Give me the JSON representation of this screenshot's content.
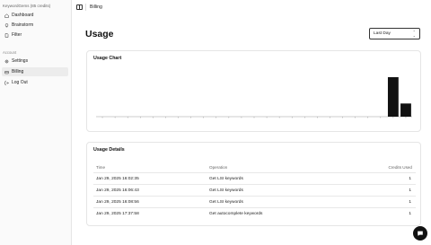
{
  "sidebar": {
    "brand": "KeywordGems (85 credits)",
    "items": [
      {
        "label": "Dashboard",
        "icon": "home-icon"
      },
      {
        "label": "Brainstorm",
        "icon": "lightbulb-icon"
      },
      {
        "label": "Filter",
        "icon": "file-icon"
      }
    ],
    "account_label": "Account",
    "account_items": [
      {
        "label": "Settings",
        "icon": "gear-icon"
      },
      {
        "label": "Billing",
        "icon": "credit-card-icon",
        "active": true
      },
      {
        "label": "Log Out",
        "icon": "logout-icon"
      }
    ]
  },
  "header": {
    "breadcrumb": "Billing"
  },
  "page": {
    "title": "Usage",
    "range_select": "Last Day"
  },
  "usage_chart": {
    "title": "Usage Chart"
  },
  "chart_data": {
    "type": "bar",
    "title": "Usage Chart",
    "values": [
      0,
      0,
      0,
      0,
      0,
      0,
      0,
      0,
      0,
      0,
      0,
      0,
      0,
      0,
      0,
      0,
      0,
      0,
      0,
      0,
      0,
      0,
      0,
      3,
      1
    ],
    "grid": false
  },
  "usage_details": {
    "title": "Usage Details",
    "columns": [
      "Time",
      "Operation",
      "Credits Used"
    ],
    "rows": [
      {
        "time": "Jan 29, 2025 16:02:35",
        "operation": "Get LSI keywords",
        "credits": "1"
      },
      {
        "time": "Jan 29, 2025 16:06:43",
        "operation": "Get LSI keywords",
        "credits": "1"
      },
      {
        "time": "Jan 29, 2025 16:08:56",
        "operation": "Get LSI keywords",
        "credits": "1"
      },
      {
        "time": "Jan 29, 2025 17:37:58",
        "operation": "Get autocomplete keywords",
        "credits": "1"
      }
    ]
  },
  "colors": {
    "accent": "#111111",
    "border": "#e5e5e5",
    "sidebar_bg": "#fafafa"
  }
}
